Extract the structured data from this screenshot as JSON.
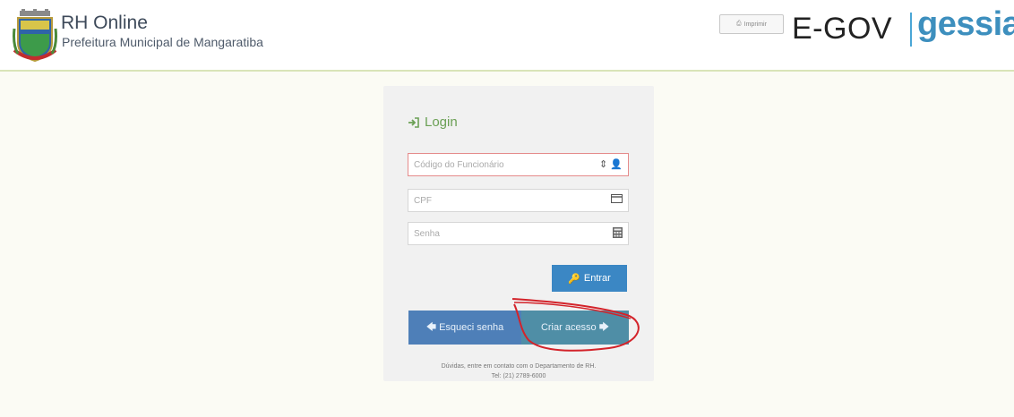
{
  "header": {
    "app_title": "RH Online",
    "app_subtitle": "Prefeitura Municipal de Mangaratiba",
    "print_label": "Imprimir",
    "egov_label": "E-GOV",
    "brand_label": "gessiap",
    "brand_color": "#3d8fbe",
    "divider_color": "#4aa6d6"
  },
  "login": {
    "heading": "Login",
    "heading_icon": "sign-in-icon",
    "accent_color": "#6ba055",
    "fields": [
      {
        "placeholder": "Código do Funcionário",
        "value": "",
        "icon": "user-icon",
        "state": "error"
      },
      {
        "placeholder": "CPF",
        "value": "",
        "icon": "card-icon"
      },
      {
        "placeholder": "Senha",
        "value": "",
        "icon": "keypad-icon"
      }
    ],
    "submit_label": "Entrar",
    "submit_color": "#3b87c4",
    "forgot_label": "Esqueci senha",
    "create_label": "Criar acesso",
    "help_line1": "Dúvidas, entre em contato com o Departamento de RH.",
    "help_line2": "Tel: (21) 2789-6000"
  },
  "annotation": {
    "color": "#d3232a",
    "shape": "hand-drawn circle around Criar acesso"
  }
}
